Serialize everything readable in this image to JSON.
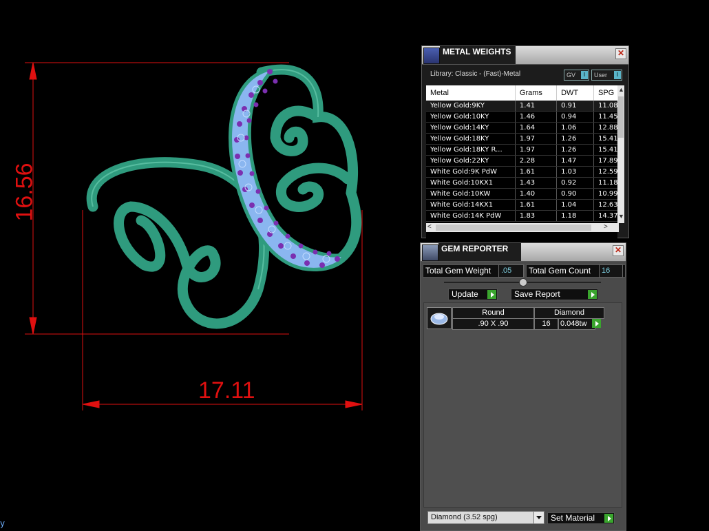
{
  "viewport": {
    "dim_horizontal": "17.11",
    "dim_vertical": "16.56",
    "corner_label": "y",
    "colors": {
      "dimension": "#e01010",
      "metal": "#2f9b7e",
      "gem": "#8ab6f0",
      "prong": "#7b2fb0"
    }
  },
  "metal_weights": {
    "title": "METAL WEIGHTS",
    "library": "Library: Classic - (Fast)-Metal",
    "toggles": [
      {
        "label": "GV"
      },
      {
        "label": "User"
      }
    ],
    "columns": [
      "Metal",
      "Grams",
      "DWT",
      "SPG"
    ],
    "rows": [
      [
        "Yellow Gold:9KY",
        "1.41",
        "0.91",
        "11.08"
      ],
      [
        "Yellow Gold:10KY",
        "1.46",
        "0.94",
        "11.45"
      ],
      [
        "Yellow Gold:14KY",
        "1.64",
        "1.06",
        "12.88"
      ],
      [
        "Yellow Gold:18KY",
        "1.97",
        "1.26",
        "15.41"
      ],
      [
        "Yellow Gold:18KY R...",
        "1.97",
        "1.26",
        "15.41"
      ],
      [
        "Yellow Gold:22KY",
        "2.28",
        "1.47",
        "17.89"
      ],
      [
        "White Gold:9K PdW",
        "1.61",
        "1.03",
        "12.59"
      ],
      [
        "White Gold:10KX1",
        "1.43",
        "0.92",
        "11.18"
      ],
      [
        "White Gold:10KW",
        "1.40",
        "0.90",
        "10.99"
      ],
      [
        "White Gold:14KX1",
        "1.61",
        "1.04",
        "12.63"
      ],
      [
        "White Gold:14K PdW",
        "1.83",
        "1.18",
        "14.37"
      ]
    ]
  },
  "gem_reporter": {
    "title": "GEM REPORTER",
    "total_weight_label": "Total Gem Weight",
    "total_weight_value": ".05",
    "total_count_label": "Total Gem Count",
    "total_count_value": "16",
    "update_label": "Update",
    "save_report_label": "Save Report",
    "gem": {
      "shape": "Round",
      "size": ".90 X .90",
      "material": "Diamond",
      "count": "16",
      "weight": "0.048tw"
    },
    "material_select": "Diamond     (3.52 spg)",
    "set_material_label": "Set Material"
  }
}
